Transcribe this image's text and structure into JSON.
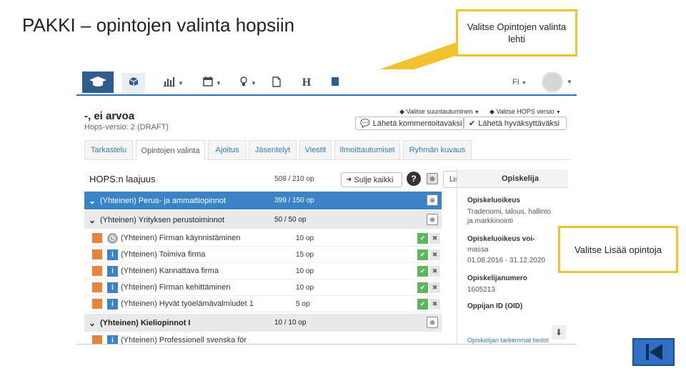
{
  "slide": {
    "title": "PAKKI – opintojen valinta hopsiin",
    "callout_tab": "Valitse Opintojen valinta lehti",
    "callout_add": "Valitse Lisää opintoja"
  },
  "colors": {
    "callout_border": "#f2c12e",
    "nav_blue": "#2f5e8e",
    "group_blue": "#3b83c8",
    "course_orange": "#e8823d",
    "accept_green": "#5cb85c"
  },
  "navbar": {
    "items": [
      {
        "icon": "graduation-cap-icon"
      },
      {
        "icon": "cube-icon"
      },
      {
        "icon": "bar-chart-icon"
      },
      {
        "icon": "calendar-icon"
      },
      {
        "icon": "lightbulb-icon"
      },
      {
        "icon": "document-icon"
      },
      {
        "icon": "heading-icon",
        "text": "H"
      },
      {
        "icon": "bookmark-icon"
      }
    ],
    "language": "FI"
  },
  "student": {
    "name": "-, ei arvoa",
    "hops_version": "Hops-versio: 2 (DRAFT)"
  },
  "header_actions": {
    "select_orientation": "Valitse suuntautuminen",
    "select_hops_version": "Valitse HOPS versio",
    "send_comment": "Lähetä kommentoitavaksi",
    "send_approval": "Lähetä hyväksyttäväksi"
  },
  "tabs": [
    {
      "label": "Tarkastelu"
    },
    {
      "label": "Opintojen valinta"
    },
    {
      "label": "Ajoitus"
    },
    {
      "label": "Jäsentelyt"
    },
    {
      "label": "Viestit"
    },
    {
      "label": "Ilmoittautumiset"
    },
    {
      "label": "Ryhmän kuvaus"
    }
  ],
  "plan": {
    "title": "HOPS:n laajuus",
    "credits": "508 / 210 op",
    "close_all": "Sulje kaikki",
    "help": "?",
    "add_studies_tooltip": "Lisää opintoja",
    "groups": [
      {
        "title": "(Yhteinen) Perus- ja ammattiopinnot",
        "credits": "399 / 150 op"
      },
      {
        "title": "(Yhteinen) Yrityksen perustoiminnot",
        "credits": "50 / 50 op"
      },
      {
        "title": "(Yhteinen) Kieliopinnot I",
        "credits": "10 / 10 op"
      }
    ],
    "courses": [
      {
        "title": "(Yhteinen) Firman käynnistäminen",
        "credits": "10 op",
        "icon": "clock-icon"
      },
      {
        "title": "(Yhteinen) Toimiva firma",
        "credits": "15 op",
        "icon": "info-icon"
      },
      {
        "title": "(Yhteinen) Kannattava firma",
        "credits": "10 op",
        "icon": "info-icon"
      },
      {
        "title": "(Yhteinen) Firman kehittäminen",
        "credits": "10 op",
        "icon": "info-icon"
      },
      {
        "title": "(Yhteinen) Hyvät työelämävalmiudet 1",
        "credits": "5 op",
        "icon": "info-icon"
      },
      {
        "title": "(Yhteinen) Professionell svenska för",
        "credits": "",
        "icon": "info-icon"
      }
    ]
  },
  "side_panel": {
    "title": "Opiskelija",
    "study_right_label": "Opiskeluoikeus",
    "study_right_value_1": "Tradenomi, talous, hallinto",
    "study_right_value_2": "ja markkinointi",
    "study_right_valid_label_1": "Opiskeluoikeus voi-",
    "study_right_valid_label_2": "massa",
    "study_right_valid_value": "01.08.2016 - 31.12.2020",
    "student_number_label": "Opiskelijanumero",
    "student_number_value": "1605213",
    "learner_id_label": "Oppijan ID (OID)",
    "more_info_link": "Opiskelijan tarkemmat tiedot"
  }
}
